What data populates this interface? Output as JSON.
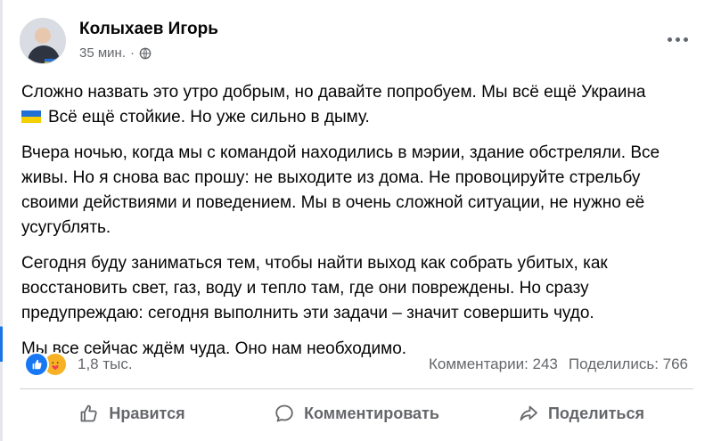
{
  "post": {
    "author": "Колыхаев Игорь",
    "time": "35 мин.",
    "separator": "·",
    "privacy_icon": "globe-icon",
    "paragraphs": [
      "Сложно назвать это утро добрым, но давайте попробуем. Мы всё ещё Украина",
      "Всё ещё стойкие. Но уже сильно в дыму.",
      "Вчера ночью, когда мы с командой находились в мэрии, здание обстреляли. Все живы. Но я снова вас прошу: не выходите из дома. Не провоцируйте стрельбу своими действиями и поведением. Мы в очень сложной ситуации, не нужно её усугублять.",
      "Сегодня буду заниматься тем, чтобы найти выход как собрать убитых, как восстановить свет, газ, воду и тепло там, где они повреждены. Но сразу предупреждаю: сегодня выполнить эти задачи – значит совершить чудо.",
      "Мы все сейчас ждём чуда. Оно нам необходимо."
    ],
    "flag_emoji": "ukraine-flag"
  },
  "stats": {
    "reactions_count": "1,8 тыс.",
    "comments": "Комментарии: 243",
    "shares": "Поделились: 766",
    "reaction_icons": [
      "like-reaction-icon",
      "care-reaction-icon"
    ]
  },
  "actions": {
    "like": "Нравится",
    "comment": "Комментировать",
    "share": "Поделиться"
  },
  "colors": {
    "secondary_text": "#65676b",
    "like_blue": "#1877f2",
    "care_yellow": "#f7b125"
  }
}
